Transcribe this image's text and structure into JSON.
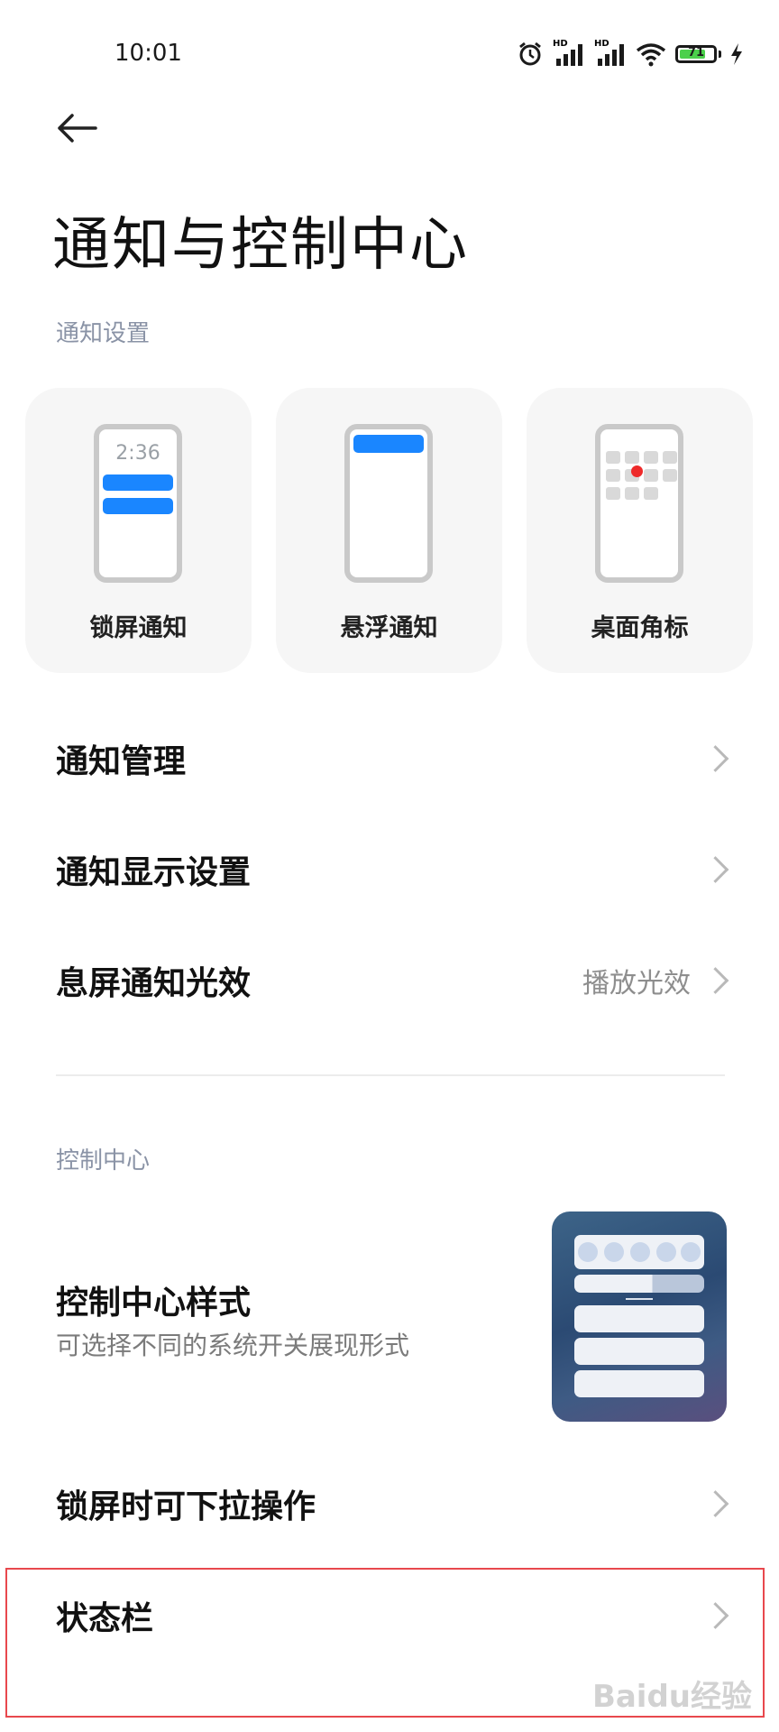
{
  "status_bar": {
    "time": "10:01",
    "signal_1_label": "HD",
    "signal_2_label": "HD",
    "battery_level": "71",
    "icons": [
      "alarm-icon",
      "signal-icon",
      "signal-icon",
      "wifi-icon",
      "battery-icon",
      "charging-icon"
    ]
  },
  "page": {
    "title": "通知与控制中心"
  },
  "notification_settings": {
    "section_label": "通知设置",
    "cards": [
      {
        "label": "锁屏通知",
        "preview_time": "2:36"
      },
      {
        "label": "悬浮通知"
      },
      {
        "label": "桌面角标"
      }
    ],
    "rows": [
      {
        "title": "通知管理"
      },
      {
        "title": "通知显示设置"
      },
      {
        "title": "息屏通知光效",
        "value": "播放光效"
      }
    ]
  },
  "control_center": {
    "section_label": "控制中心",
    "style_item": {
      "title": "控制中心样式",
      "subtitle": "可选择不同的系统开关展现形式"
    },
    "rows": [
      {
        "title": "锁屏时可下拉操作"
      },
      {
        "title": "状态栏"
      }
    ]
  },
  "watermark": "Baidu经验",
  "colors": {
    "accent_blue": "#1a86ff",
    "section_label": "#8a93a6",
    "highlight_border": "#e8484d",
    "badge_red": "#ee2a2a"
  }
}
